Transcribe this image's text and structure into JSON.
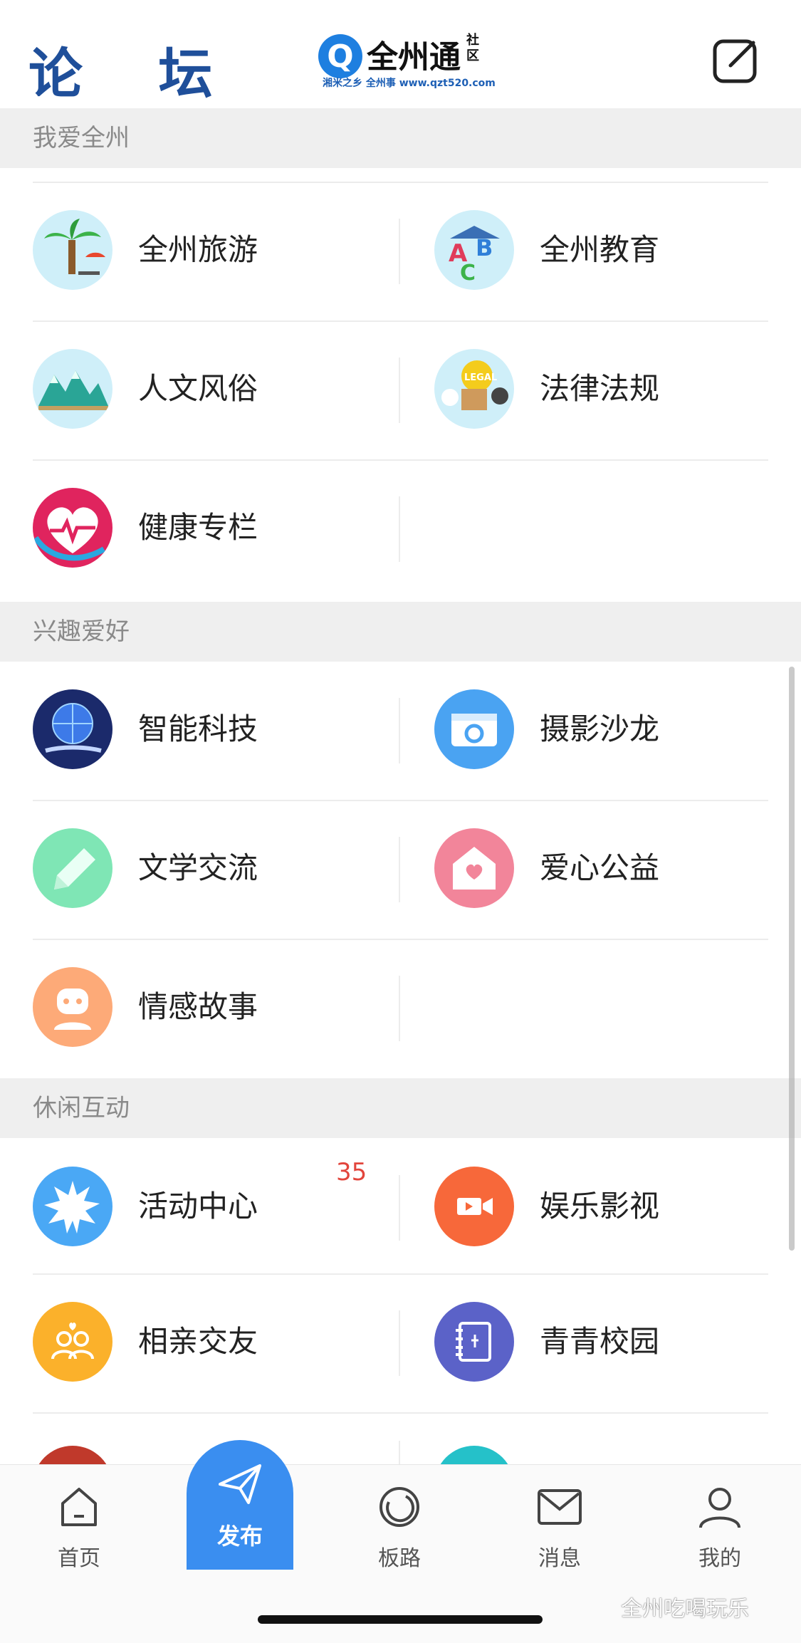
{
  "header": {
    "title": "论 坛",
    "logo": {
      "mark": "Q",
      "name": "全州通",
      "suffix": "社区",
      "slogan": "湘米之乡 全州事 www.qzt520.com"
    }
  },
  "sections": [
    {
      "title": "我爱全州",
      "rows": [
        [
          {
            "label": "全州旅游",
            "icon": "palm-tree-icon",
            "color": "#cfeff9"
          },
          {
            "label": "全州教育",
            "icon": "abc-blocks-icon",
            "color": "#cfeff9"
          }
        ],
        [
          {
            "label": "人文风俗",
            "icon": "mountains-icon",
            "color": "#cfeff9"
          },
          {
            "label": "法律法规",
            "icon": "legal-scale-icon",
            "color": "#cfeff9"
          }
        ],
        [
          {
            "label": "健康专栏",
            "icon": "heart-pulse-icon",
            "color": "#e0245e"
          },
          null
        ]
      ]
    },
    {
      "title": "兴趣爱好",
      "rows": [
        [
          {
            "label": "智能科技",
            "icon": "globe-hand-icon",
            "color": "#1b2a6b"
          },
          {
            "label": "摄影沙龙",
            "icon": "camera-icon",
            "color": "#4aa3f2"
          }
        ],
        [
          {
            "label": "文学交流",
            "icon": "pencil-icon",
            "color": "#7fe6b5"
          },
          {
            "label": "爱心公益",
            "icon": "heart-house-icon",
            "color": "#f2859a"
          }
        ],
        [
          {
            "label": "情感故事",
            "icon": "face-icon",
            "color": "#fdaa78"
          },
          null
        ]
      ]
    },
    {
      "title": "休闲互动",
      "rows": [
        [
          {
            "label": "活动中心",
            "icon": "sun-icon",
            "color": "#4aa8f5",
            "badge": "35"
          },
          {
            "label": "娱乐影视",
            "icon": "video-camera-icon",
            "color": "#f7683a"
          }
        ],
        [
          {
            "label": "相亲交友",
            "icon": "couple-icon",
            "color": "#fbb12b"
          },
          {
            "label": "青青校园",
            "icon": "notebook-icon",
            "color": "#5b62c8"
          }
        ]
      ]
    }
  ],
  "bottom_nav": {
    "home": "首页",
    "publish": "发布",
    "boards": "板路",
    "messages": "消息",
    "mine": "我的"
  },
  "watermark": "全州吃喝玩乐"
}
